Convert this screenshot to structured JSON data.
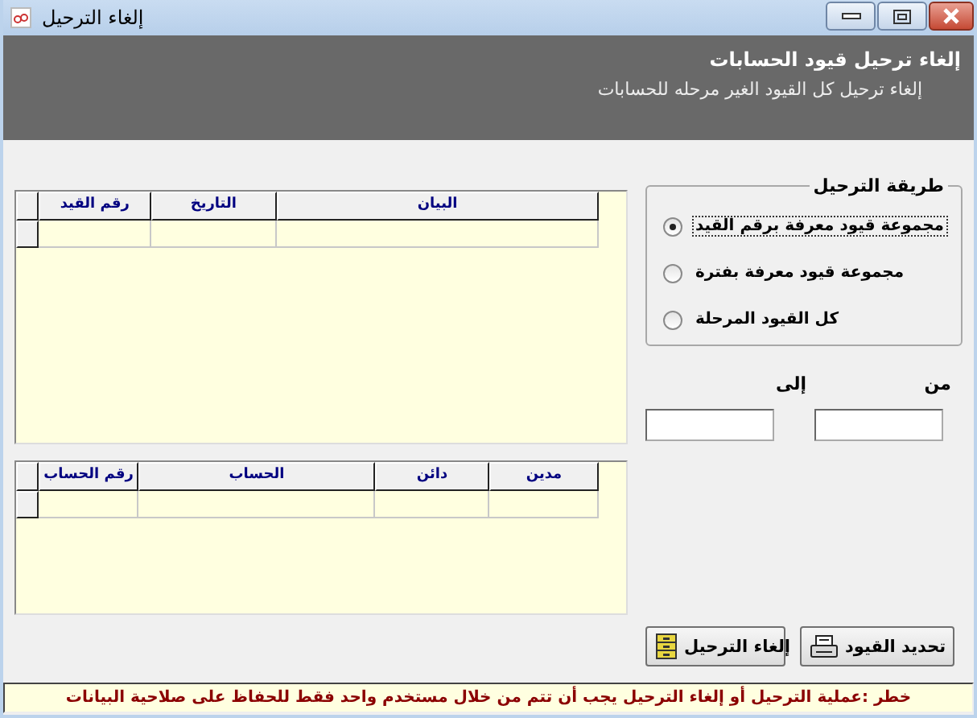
{
  "window": {
    "title": "إلغاء الترحيل"
  },
  "header": {
    "title": "إلغاء ترحيل قيود الحسابات",
    "subtitle": "إلغاء ترحيل كل القيود الغير مرحله للحسابات"
  },
  "entries_grid": {
    "columns": [
      "البيان",
      "التاريخ",
      "رقم القيد"
    ]
  },
  "accounts_grid": {
    "columns": [
      "مدين",
      "دائن",
      "الحساب",
      "رقم الحساب"
    ]
  },
  "posting_method": {
    "title": "طريقة الترحيل",
    "options": [
      {
        "label": "مجموعة قيود معرفة برقم القيد",
        "selected": true
      },
      {
        "label": "مجموعة قيود معرفة بفترة",
        "selected": false
      },
      {
        "label": "كل القيود المرحلة",
        "selected": false
      }
    ]
  },
  "range": {
    "from_label": "من",
    "to_label": "إلى"
  },
  "buttons": [
    {
      "label": "تحديد القيود",
      "kind": "select"
    },
    {
      "label": "إلغاء الترحيل",
      "kind": "unpost"
    }
  ],
  "status": "خطر :عملية الترحيل أو إلغاء الترحيل يجب أن تتم من خلال مستخدم واحد فقط للحفاظ على صلاحية البيانات"
}
